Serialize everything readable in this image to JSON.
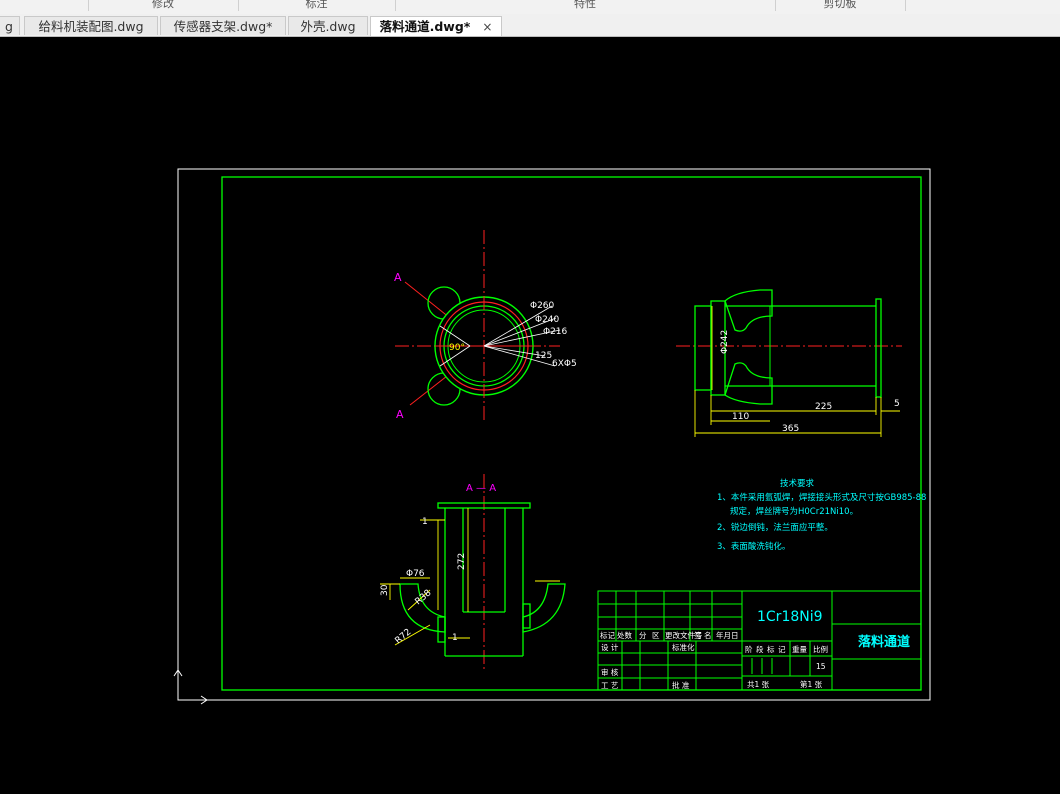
{
  "ribbon": {
    "groups": [
      "修改",
      "标注",
      "特性",
      "剪切板"
    ]
  },
  "tabs": [
    {
      "label": "g"
    },
    {
      "label": "给料机装配图.dwg"
    },
    {
      "label": "传感器支架.dwg*"
    },
    {
      "label": "外壳.dwg"
    },
    {
      "label": "落料通道.dwg*",
      "close": "×"
    }
  ],
  "drawing": {
    "colors": {
      "green": "#00ff00",
      "yellow": "#ffff00",
      "red": "#ff2020",
      "magenta": "#ff00ff",
      "cyan": "#00ffff",
      "white": "#ffffff"
    },
    "top_view": {
      "section_mark": "A",
      "dims": [
        "Φ260",
        "Φ240",
        "Φ216",
        "125",
        "6XΦ5",
        "90°"
      ]
    },
    "side_view": {
      "dims": [
        "Φ242",
        "110",
        "225",
        "365",
        "5"
      ]
    },
    "section_view": {
      "title": "A — A",
      "dims": [
        "1",
        "272",
        "Φ76",
        "30",
        "R38",
        "R72",
        "1"
      ]
    },
    "notes": {
      "title": "技术要求",
      "lines": [
        "1、本件采用氩弧焊，焊接接头形式及尺寸按GB985-88",
        "规定，焊丝牌号为H0Cr21Ni10。",
        "2、锐边倒钝，法兰面应平整。",
        "3、表面酸洗钝化。"
      ]
    },
    "title_block": {
      "material": "1Cr18Ni9",
      "part_name": "落料通道",
      "scale_value": "15",
      "header_row": [
        "标记",
        "处数",
        "分",
        "区",
        "更改文件号",
        "签",
        "名",
        "年月日"
      ],
      "design": "设 计",
      "std": "标准化",
      "stage_labels": [
        "阶",
        "段",
        "标",
        "记",
        "重量",
        "比例"
      ],
      "review": "审 核",
      "process": "工 艺",
      "approve": "批 准",
      "total": "共1  张",
      "sheet": "第1  张"
    }
  }
}
